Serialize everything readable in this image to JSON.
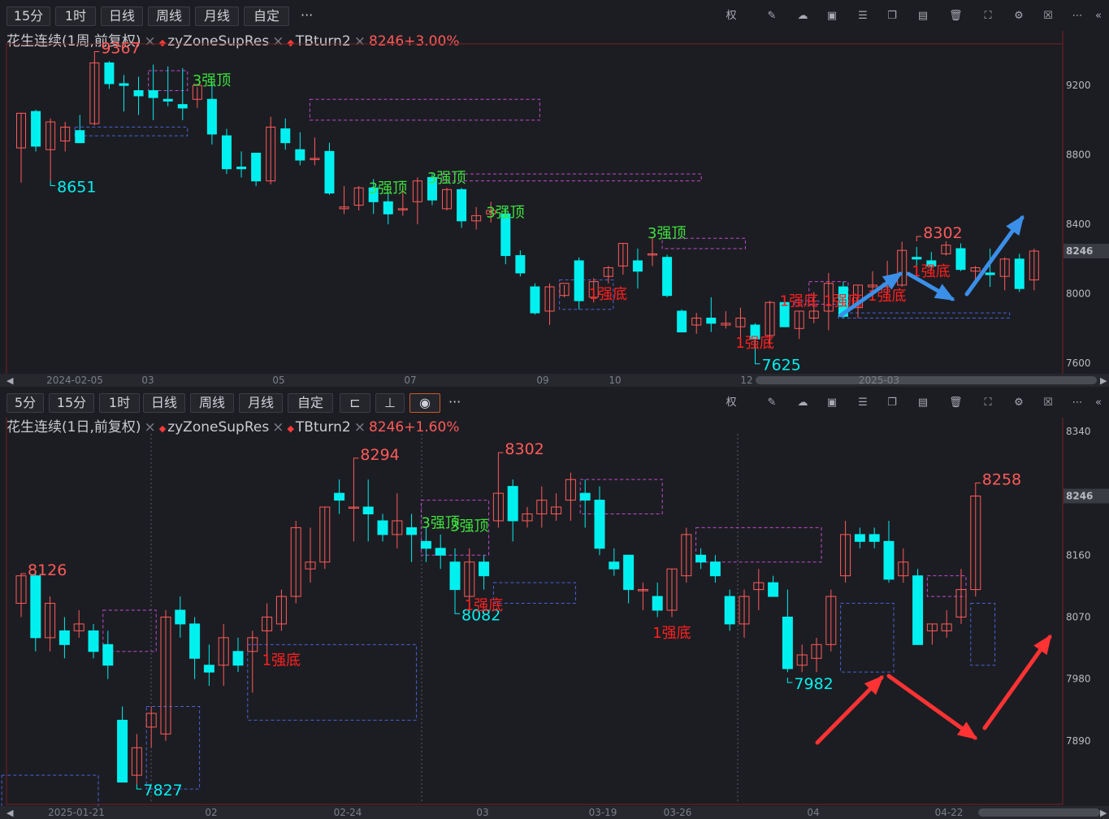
{
  "top": {
    "toolbar": {
      "buttons": [
        "15分",
        "1时",
        "日线",
        "周线",
        "月线",
        "自定"
      ],
      "more": "···",
      "icons": [
        "rights-icon",
        "pencil-icon",
        "cloud-icon",
        "image-icon",
        "sliders-icon",
        "copy-icon",
        "layout-icon",
        "trash-icon",
        "fullscreen-icon",
        "gear-icon",
        "close-window-icon",
        "collapse-icon"
      ],
      "rights_label": "权"
    },
    "title": {
      "main": "花生连续(1周,前复权)",
      "ind1": "zyZoneSupRes",
      "ind2": "TBturn2",
      "price": "8246+3.00%"
    },
    "price_tag": "8246"
  },
  "bottom": {
    "toolbar": {
      "buttons": [
        "5分",
        "15分",
        "1时",
        "日线",
        "周线",
        "月线",
        "自定"
      ],
      "more": "···",
      "rights_label": "权"
    },
    "title": {
      "main": "花生连续(1日,前复权)",
      "ind1": "zyZoneSupRes",
      "ind2": "TBturn2",
      "price": "8246+1.60%"
    },
    "price_tag": "8246"
  },
  "colors": {
    "up": "#ff5a5a",
    "down": "#00f0f0",
    "zone_res": "#c04ad0",
    "zone_sup": "#4a62d8",
    "green_label": "#3fe03f",
    "red_label": "#ff2020",
    "arrow_blue": "#3b8fe8",
    "arrow_red": "#ff3333",
    "bg": "#1c1d22"
  },
  "chart_data": [
    {
      "type": "candlestick",
      "title": "花生连续(1周,前复权)",
      "y_ticks": [
        9200,
        8800,
        8400,
        8000,
        7600
      ],
      "ylim": [
        7530,
        9430
      ],
      "x_ticks": [
        "2024-02-05",
        "03",
        "05",
        "07",
        "09",
        "10",
        "12",
        "2025-03"
      ],
      "candles": [
        {
          "o": 8840,
          "h": 9040,
          "l": 8640,
          "c": 9040
        },
        {
          "o": 9050,
          "h": 9060,
          "l": 8820,
          "c": 8850
        },
        {
          "o": 8830,
          "h": 9010,
          "l": 8650,
          "c": 8990
        },
        {
          "o": 8880,
          "h": 8990,
          "l": 8820,
          "c": 8960
        },
        {
          "o": 8940,
          "h": 9030,
          "l": 8870,
          "c": 8870
        },
        {
          "o": 8980,
          "h": 9367,
          "l": 8970,
          "c": 9330
        },
        {
          "o": 9330,
          "h": 9340,
          "l": 9180,
          "c": 9210
        },
        {
          "o": 9210,
          "h": 9260,
          "l": 9050,
          "c": 9200
        },
        {
          "o": 9170,
          "h": 9250,
          "l": 9030,
          "c": 9140
        },
        {
          "o": 9170,
          "h": 9320,
          "l": 9000,
          "c": 9130
        },
        {
          "o": 9120,
          "h": 9310,
          "l": 9080,
          "c": 9110
        },
        {
          "o": 9090,
          "h": 9300,
          "l": 9000,
          "c": 9070
        },
        {
          "o": 9120,
          "h": 9190,
          "l": 9070,
          "c": 9200
        },
        {
          "o": 9120,
          "h": 9220,
          "l": 8860,
          "c": 8920
        },
        {
          "o": 8910,
          "h": 8950,
          "l": 8690,
          "c": 8720
        },
        {
          "o": 8730,
          "h": 8820,
          "l": 8670,
          "c": 8720
        },
        {
          "o": 8810,
          "h": 8810,
          "l": 8620,
          "c": 8650
        },
        {
          "o": 8650,
          "h": 9020,
          "l": 8630,
          "c": 8960
        },
        {
          "o": 8950,
          "h": 9010,
          "l": 8830,
          "c": 8870
        },
        {
          "o": 8830,
          "h": 8930,
          "l": 8740,
          "c": 8770
        },
        {
          "o": 8780,
          "h": 8900,
          "l": 8740,
          "c": 8780
        },
        {
          "o": 8820,
          "h": 8870,
          "l": 8570,
          "c": 8580
        },
        {
          "o": 8490,
          "h": 8620,
          "l": 8460,
          "c": 8500
        },
        {
          "o": 8510,
          "h": 8620,
          "l": 8480,
          "c": 8610
        },
        {
          "o": 8610,
          "h": 8660,
          "l": 8460,
          "c": 8530
        },
        {
          "o": 8530,
          "h": 8580,
          "l": 8400,
          "c": 8460
        },
        {
          "o": 8490,
          "h": 8620,
          "l": 8450,
          "c": 8490
        },
        {
          "o": 8530,
          "h": 8670,
          "l": 8400,
          "c": 8650
        },
        {
          "o": 8670,
          "h": 8690,
          "l": 8510,
          "c": 8540
        },
        {
          "o": 8490,
          "h": 8610,
          "l": 8480,
          "c": 8600
        },
        {
          "o": 8600,
          "h": 8610,
          "l": 8380,
          "c": 8420
        },
        {
          "o": 8420,
          "h": 8500,
          "l": 8370,
          "c": 8450
        },
        {
          "o": 8460,
          "h": 8530,
          "l": 8410,
          "c": 8480
        },
        {
          "o": 8460,
          "h": 8500,
          "l": 8170,
          "c": 8220
        },
        {
          "o": 8220,
          "h": 8250,
          "l": 8100,
          "c": 8120
        },
        {
          "o": 8040,
          "h": 8060,
          "l": 7880,
          "c": 7890
        },
        {
          "o": 7900,
          "h": 8060,
          "l": 7820,
          "c": 8040
        },
        {
          "o": 7990,
          "h": 8050,
          "l": 7980,
          "c": 8060
        },
        {
          "o": 8190,
          "h": 8210,
          "l": 7910,
          "c": 7960
        },
        {
          "o": 7980,
          "h": 8090,
          "l": 7950,
          "c": 8070
        },
        {
          "o": 8100,
          "h": 8160,
          "l": 8060,
          "c": 8150
        },
        {
          "o": 8160,
          "h": 8290,
          "l": 8110,
          "c": 8290
        },
        {
          "o": 8190,
          "h": 8260,
          "l": 8030,
          "c": 8130
        },
        {
          "o": 8230,
          "h": 8325,
          "l": 8160,
          "c": 8230
        },
        {
          "o": 8210,
          "h": 8225,
          "l": 7980,
          "c": 7990
        },
        {
          "o": 7900,
          "h": 7910,
          "l": 7780,
          "c": 7780
        },
        {
          "o": 7820,
          "h": 7890,
          "l": 7770,
          "c": 7860
        },
        {
          "o": 7860,
          "h": 7980,
          "l": 7780,
          "c": 7830
        },
        {
          "o": 7820,
          "h": 7900,
          "l": 7800,
          "c": 7830
        },
        {
          "o": 7810,
          "h": 7920,
          "l": 7740,
          "c": 7860
        },
        {
          "o": 7820,
          "h": 7830,
          "l": 7625,
          "c": 7740
        },
        {
          "o": 7760,
          "h": 7960,
          "l": 7690,
          "c": 7950
        },
        {
          "o": 7950,
          "h": 7990,
          "l": 7810,
          "c": 7810
        },
        {
          "o": 7800,
          "h": 7900,
          "l": 7740,
          "c": 7900
        },
        {
          "o": 7860,
          "h": 8010,
          "l": 7830,
          "c": 7900
        },
        {
          "o": 7900,
          "h": 8120,
          "l": 7790,
          "c": 8060
        },
        {
          "o": 8040,
          "h": 8070,
          "l": 7860,
          "c": 7870
        },
        {
          "o": 7920,
          "h": 8050,
          "l": 7860,
          "c": 8050
        },
        {
          "o": 8040,
          "h": 8130,
          "l": 7990,
          "c": 8050
        },
        {
          "o": 8040,
          "h": 8190,
          "l": 8000,
          "c": 8060
        },
        {
          "o": 8050,
          "h": 8300,
          "l": 8040,
          "c": 8250
        },
        {
          "o": 8210,
          "h": 8270,
          "l": 8110,
          "c": 8200
        },
        {
          "o": 8190,
          "h": 8240,
          "l": 8140,
          "c": 8160
        },
        {
          "o": 8230,
          "h": 8302,
          "l": 8220,
          "c": 8280
        },
        {
          "o": 8260,
          "h": 8290,
          "l": 8130,
          "c": 8140
        },
        {
          "o": 8130,
          "h": 8160,
          "l": 8070,
          "c": 8150
        },
        {
          "o": 8120,
          "h": 8260,
          "l": 8040,
          "c": 8110
        },
        {
          "o": 8100,
          "h": 8210,
          "l": 8020,
          "c": 8200
        },
        {
          "o": 8200,
          "h": 8230,
          "l": 8010,
          "c": 8030
        },
        {
          "o": 8080,
          "h": 8260,
          "l": 8020,
          "c": 8246
        }
      ],
      "labels": [
        {
          "text": "9367",
          "kind": "high"
        },
        {
          "text": "8651",
          "kind": "low"
        },
        {
          "text": "3强顶",
          "kind": "top"
        },
        {
          "text": "3强顶",
          "kind": "top"
        },
        {
          "text": "3强顶",
          "kind": "top"
        },
        {
          "text": "3强顶",
          "kind": "top"
        },
        {
          "text": "3强顶",
          "kind": "top"
        },
        {
          "text": "1强底",
          "kind": "bottom"
        },
        {
          "text": "1强底",
          "kind": "bottom"
        },
        {
          "text": "1强底",
          "kind": "bottom"
        },
        {
          "text": "1强底",
          "kind": "bottom"
        },
        {
          "text": "1强底",
          "kind": "bottom"
        },
        {
          "text": "1强底",
          "kind": "bottom"
        },
        {
          "text": "7625",
          "kind": "low"
        },
        {
          "text": "8302",
          "kind": "high"
        }
      ]
    },
    {
      "type": "candlestick",
      "title": "花生连续(1日,前复权)",
      "y_ticks": [
        8340,
        8246,
        8160,
        8070,
        7980,
        7890
      ],
      "ylim": [
        7800,
        8360
      ],
      "x_ticks": [
        "2025-01-21",
        "02",
        "02-24",
        "03",
        "03-19",
        "03-26",
        "04",
        "04-22"
      ],
      "candles": [
        {
          "o": 8090,
          "h": 8130,
          "l": 8070,
          "c": 8130
        },
        {
          "o": 8130,
          "h": 8135,
          "l": 8020,
          "c": 8040
        },
        {
          "o": 8040,
          "h": 8100,
          "l": 8020,
          "c": 8090
        },
        {
          "o": 8050,
          "h": 8070,
          "l": 8010,
          "c": 8030
        },
        {
          "o": 8050,
          "h": 8080,
          "l": 8040,
          "c": 8060
        },
        {
          "o": 8050,
          "h": 8060,
          "l": 8010,
          "c": 8020
        },
        {
          "o": 8030,
          "h": 8050,
          "l": 7980,
          "c": 8000
        },
        {
          "o": 7920,
          "h": 7940,
          "l": 7830,
          "c": 7830
        },
        {
          "o": 7840,
          "h": 7900,
          "l": 7827,
          "c": 7880
        },
        {
          "o": 7910,
          "h": 7940,
          "l": 7880,
          "c": 7930
        },
        {
          "o": 7900,
          "h": 8080,
          "l": 7890,
          "c": 8070
        },
        {
          "o": 8080,
          "h": 8100,
          "l": 8040,
          "c": 8060
        },
        {
          "o": 8060,
          "h": 8070,
          "l": 7980,
          "c": 8010
        },
        {
          "o": 8000,
          "h": 8030,
          "l": 7970,
          "c": 7990
        },
        {
          "o": 8000,
          "h": 8060,
          "l": 7970,
          "c": 8040
        },
        {
          "o": 8020,
          "h": 8040,
          "l": 7990,
          "c": 8000
        },
        {
          "o": 8020,
          "h": 8050,
          "l": 7960,
          "c": 8040
        },
        {
          "o": 8050,
          "h": 8090,
          "l": 8000,
          "c": 8070
        },
        {
          "o": 8060,
          "h": 8110,
          "l": 8050,
          "c": 8100
        },
        {
          "o": 8100,
          "h": 8210,
          "l": 8090,
          "c": 8200
        },
        {
          "o": 8140,
          "h": 8200,
          "l": 8120,
          "c": 8150
        },
        {
          "o": 8150,
          "h": 8230,
          "l": 8140,
          "c": 8230
        },
        {
          "o": 8250,
          "h": 8270,
          "l": 8220,
          "c": 8240
        },
        {
          "o": 8230,
          "h": 8294,
          "l": 8180,
          "c": 8230
        },
        {
          "o": 8230,
          "h": 8270,
          "l": 8180,
          "c": 8220
        },
        {
          "o": 8210,
          "h": 8220,
          "l": 8180,
          "c": 8190
        },
        {
          "o": 8190,
          "h": 8250,
          "l": 8170,
          "c": 8210
        },
        {
          "o": 8200,
          "h": 8220,
          "l": 8150,
          "c": 8190
        },
        {
          "o": 8180,
          "h": 8200,
          "l": 8150,
          "c": 8170
        },
        {
          "o": 8170,
          "h": 8190,
          "l": 8140,
          "c": 8160
        },
        {
          "o": 8150,
          "h": 8170,
          "l": 8080,
          "c": 8110
        },
        {
          "o": 8100,
          "h": 8170,
          "l": 8090,
          "c": 8150
        },
        {
          "o": 8150,
          "h": 8160,
          "l": 8110,
          "c": 8130
        },
        {
          "o": 8210,
          "h": 8302,
          "l": 8200,
          "c": 8250
        },
        {
          "o": 8260,
          "h": 8270,
          "l": 8180,
          "c": 8210
        },
        {
          "o": 8210,
          "h": 8230,
          "l": 8200,
          "c": 8220
        },
        {
          "o": 8220,
          "h": 8260,
          "l": 8200,
          "c": 8240
        },
        {
          "o": 8220,
          "h": 8250,
          "l": 8210,
          "c": 8230
        },
        {
          "o": 8240,
          "h": 8280,
          "l": 8210,
          "c": 8270
        },
        {
          "o": 8250,
          "h": 8270,
          "l": 8200,
          "c": 8240
        },
        {
          "o": 8240,
          "h": 8260,
          "l": 8160,
          "c": 8170
        },
        {
          "o": 8150,
          "h": 8170,
          "l": 8130,
          "c": 8140
        },
        {
          "o": 8160,
          "h": 8160,
          "l": 8090,
          "c": 8110
        },
        {
          "o": 8110,
          "h": 8120,
          "l": 8080,
          "c": 8110
        },
        {
          "o": 8100,
          "h": 8120,
          "l": 8070,
          "c": 8080
        },
        {
          "o": 8080,
          "h": 8140,
          "l": 8070,
          "c": 8140
        },
        {
          "o": 8130,
          "h": 8200,
          "l": 8120,
          "c": 8190
        },
        {
          "o": 8160,
          "h": 8170,
          "l": 8140,
          "c": 8150
        },
        {
          "o": 8150,
          "h": 8160,
          "l": 8120,
          "c": 8130
        },
        {
          "o": 8100,
          "h": 8110,
          "l": 8050,
          "c": 8060
        },
        {
          "o": 8060,
          "h": 8110,
          "l": 8040,
          "c": 8100
        },
        {
          "o": 8110,
          "h": 8140,
          "l": 8080,
          "c": 8120
        },
        {
          "o": 8120,
          "h": 8130,
          "l": 8100,
          "c": 8100
        },
        {
          "o": 8070,
          "h": 8110,
          "l": 7990,
          "c": 7995
        },
        {
          "o": 8000,
          "h": 8030,
          "l": 7990,
          "c": 8015
        },
        {
          "o": 8010,
          "h": 8040,
          "l": 7990,
          "c": 8030
        },
        {
          "o": 8030,
          "h": 8110,
          "l": 8020,
          "c": 8100
        },
        {
          "o": 8130,
          "h": 8210,
          "l": 8120,
          "c": 8190
        },
        {
          "o": 8190,
          "h": 8200,
          "l": 8170,
          "c": 8180
        },
        {
          "o": 8190,
          "h": 8200,
          "l": 8170,
          "c": 8180
        },
        {
          "o": 8180,
          "h": 8210,
          "l": 8120,
          "c": 8125
        },
        {
          "o": 8130,
          "h": 8170,
          "l": 8120,
          "c": 8150
        },
        {
          "o": 8130,
          "h": 8140,
          "l": 8030,
          "c": 8030
        },
        {
          "o": 8050,
          "h": 8060,
          "l": 8030,
          "c": 8060
        },
        {
          "o": 8050,
          "h": 8080,
          "l": 8040,
          "c": 8060
        },
        {
          "o": 8070,
          "h": 8140,
          "l": 8060,
          "c": 8110
        },
        {
          "o": 8110,
          "h": 8258,
          "l": 8100,
          "c": 8246
        }
      ],
      "labels": [
        {
          "text": "8126",
          "kind": "high"
        },
        {
          "text": "7827",
          "kind": "low"
        },
        {
          "text": "8294",
          "kind": "high"
        },
        {
          "text": "8302",
          "kind": "high"
        },
        {
          "text": "7982",
          "kind": "low"
        },
        {
          "text": "8258",
          "kind": "high"
        },
        {
          "text": "8082",
          "kind": "low"
        },
        {
          "text": "3强顶",
          "kind": "top"
        },
        {
          "text": "3强顶",
          "kind": "top"
        },
        {
          "text": "1强底",
          "kind": "bottom"
        },
        {
          "text": "1强底",
          "kind": "bottom"
        },
        {
          "text": "1强底",
          "kind": "bottom"
        }
      ]
    }
  ]
}
